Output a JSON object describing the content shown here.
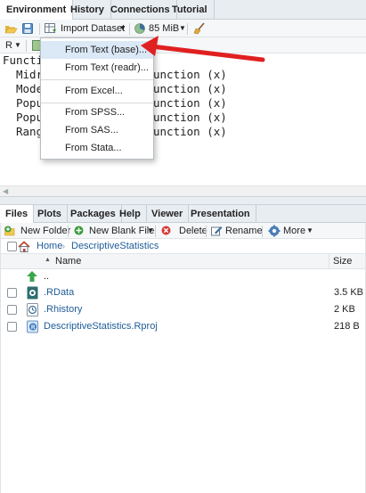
{
  "env": {
    "tabs": [
      "Environment",
      "History",
      "Connections",
      "Tutorial"
    ],
    "toolbar": {
      "import_dataset": "Import Dataset",
      "memory": "85 MiB"
    },
    "lang_select": "R",
    "section_header": "Functio",
    "rows": [
      {
        "name": "Midr",
        "value": "unction (x)"
      },
      {
        "name": "Mode",
        "value": "unction (x)"
      },
      {
        "name": "Popu",
        "value": "unction (x)"
      },
      {
        "name": "Popu",
        "value": "unction (x)"
      },
      {
        "name": "Rang",
        "value": "unction (x)"
      }
    ]
  },
  "import_menu": {
    "items": [
      "From Text (base)...",
      "From Text (readr)...",
      "From Excel...",
      "From SPSS...",
      "From SAS...",
      "From Stata..."
    ],
    "highlighted_index": 0
  },
  "files": {
    "tabs": [
      "Files",
      "Plots",
      "Packages",
      "Help",
      "Viewer",
      "Presentation"
    ],
    "toolbar": {
      "new_folder": "New Folder",
      "new_blank_file": "New Blank File",
      "delete": "Delete",
      "rename": "Rename",
      "more": "More"
    },
    "breadcrumb": [
      "Home",
      "DescriptiveStatistics"
    ],
    "columns": {
      "name": "Name",
      "size": "Size"
    },
    "parent": "..",
    "rows": [
      {
        "name": ".RData",
        "size": "3.5 KB",
        "icon": "rdata-icon"
      },
      {
        "name": ".Rhistory",
        "size": "2 KB",
        "icon": "rhistory-icon"
      },
      {
        "name": "DescriptiveStatistics.Rproj",
        "size": "218 B",
        "icon": "rproj-icon"
      }
    ]
  },
  "colors": {
    "link": "#1f5c99",
    "annotation_arrow": "#e02020",
    "menu_highlight": "#dbe8f6"
  }
}
